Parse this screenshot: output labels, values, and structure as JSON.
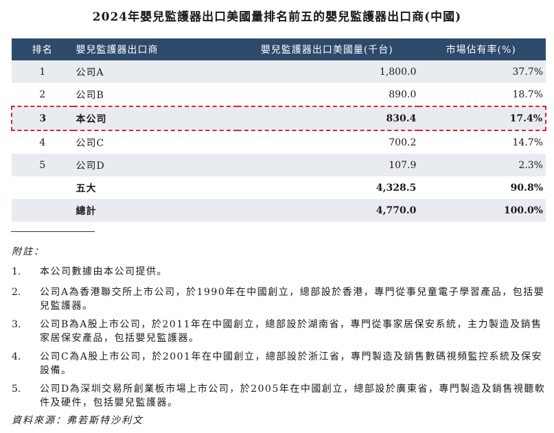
{
  "title": "2024年嬰兒監護器出口美國量排名前五的嬰兒監護器出口商(中國)",
  "table": {
    "headers": {
      "rank": "排名",
      "name": "嬰兒監護器出口商",
      "volume": "嬰兒監護器出口美國量(千台)",
      "share": "市場佔有率(%)"
    },
    "rows": [
      {
        "rank": "1",
        "name": "公司A",
        "volume": "1,800.0",
        "share": "37.7%"
      },
      {
        "rank": "2",
        "name": "公司B",
        "volume": "890.0",
        "share": "18.7%"
      },
      {
        "rank": "3",
        "name": "本公司",
        "volume": "830.4",
        "share": "17.4%"
      },
      {
        "rank": "4",
        "name": "公司C",
        "volume": "700.2",
        "share": "14.7%"
      },
      {
        "rank": "5",
        "name": "公司D",
        "volume": "107.9",
        "share": "2.3%"
      }
    ],
    "top5": {
      "name": "五大",
      "volume": "4,328.5",
      "share": "90.8%"
    },
    "total": {
      "name": "總計",
      "volume": "4,770.0",
      "share": "100.0%"
    }
  },
  "notes": {
    "title": "附註：",
    "items": [
      {
        "num": "1.",
        "text": "本公司數據由本公司提供。"
      },
      {
        "num": "2.",
        "text": "公司A為香港聯交所上市公司，於1990年在中國創立，總部設於香港，專門從事兒童電子學習產品，包括嬰兒監護器。"
      },
      {
        "num": "3.",
        "text": "公司B為A股上市公司，於2011年在中國創立，總部設於湖南省，專門從事家居保安系統，主力製造及銷售家居保安產品，包括嬰兒監護器。"
      },
      {
        "num": "4.",
        "text": "公司C為A股上市公司，於2001年在中國創立，總部設於浙江省，專門製造及銷售數碼視頻監控系統及保安設備。"
      },
      {
        "num": "5.",
        "text": "公司D為深圳交易所創業板市場上市公司，於2005年在中國創立，總部設於廣東省，專門製造及銷售視聽軟件及硬件，包括嬰兒監護器。"
      }
    ]
  },
  "source": "資料來源：弗若斯特沙利文"
}
